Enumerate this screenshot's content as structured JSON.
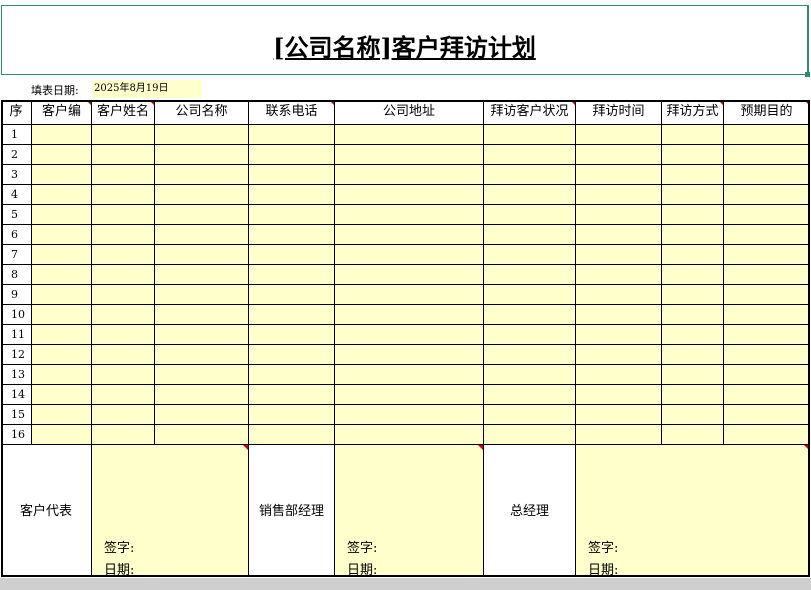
{
  "title": "[公司名称]客户拜访计划",
  "fill_date": {
    "label": "填表日期:",
    "value": "2025年8月19日"
  },
  "headers": [
    "序",
    "客户编",
    "客户姓名",
    "公司名称",
    "联系电话",
    "公司地址",
    "拜访客户状况",
    "拜访时间",
    "拜访方式",
    "预期目的"
  ],
  "row_numbers": [
    "1",
    "2",
    "3",
    "4",
    "5",
    "6",
    "7",
    "8",
    "9",
    "10",
    "11",
    "12",
    "13",
    "14",
    "15",
    "16"
  ],
  "signature": {
    "rep_label": "客户代表",
    "sales_manager_label": "销售部经理",
    "gm_label": "总经理",
    "sign_label": "签字:",
    "date_label": "日期:"
  },
  "colors": {
    "fill": "#ffffcc",
    "title_border": "#2f8b6f",
    "comment_marker": "#cc0000"
  }
}
